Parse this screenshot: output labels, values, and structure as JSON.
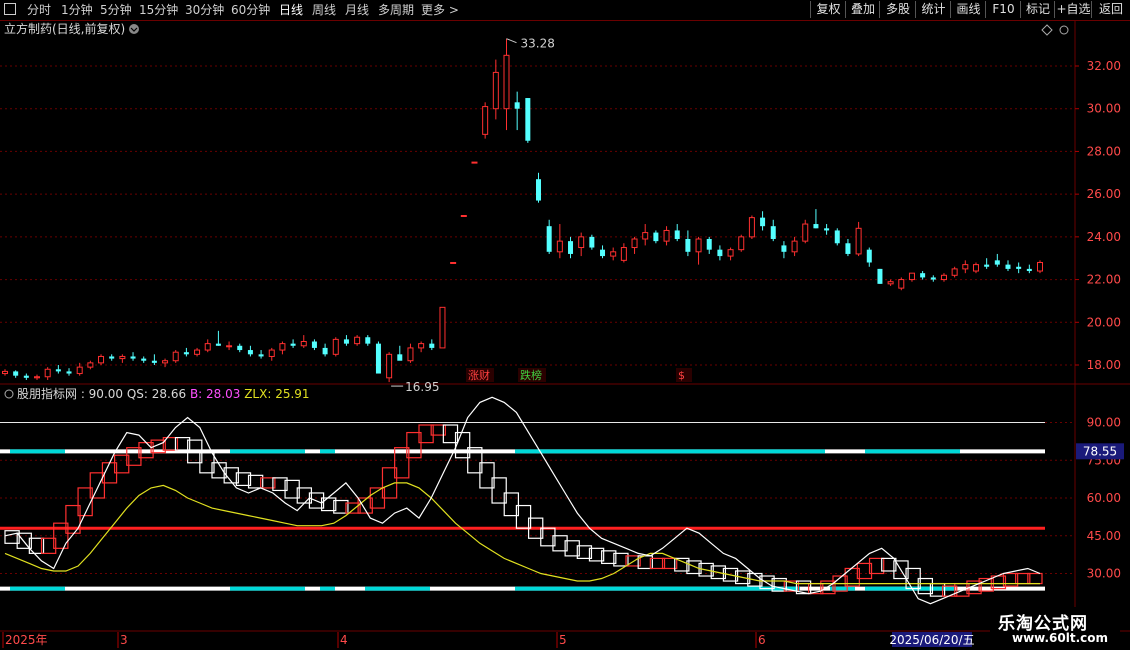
{
  "toolbar": {
    "left_items": [
      "分时",
      "1分钟",
      "5分钟",
      "15分钟",
      "30分钟",
      "60分钟",
      "日线",
      "周线",
      "月线",
      "多周期",
      "更多 >"
    ],
    "active_index": 6,
    "right_items": [
      "复权",
      "叠加",
      "多股",
      "统计",
      "画线",
      "F10",
      "标记",
      "+自选",
      "返回"
    ]
  },
  "main_panel": {
    "title": "立方制药(日线,前复权)",
    "y_ticks": [
      "32.00",
      "30.00",
      "28.00",
      "26.00",
      "24.00",
      "22.00",
      "20.00",
      "18.00"
    ],
    "high_label": "33.28",
    "low_label": "16.95",
    "markers": [
      {
        "text": "涨财",
        "color": "#ff4040"
      },
      {
        "text": "跌榜",
        "color": "#40d040"
      },
      {
        "text": "$",
        "color": "#ff4040"
      }
    ]
  },
  "indicator_panel": {
    "name": "股朋指标网",
    "params": ": 90.00",
    "qs_label": "QS: 28.66",
    "b_label": "B: 28.03",
    "zlx_label": "ZLX: 25.91",
    "y_ticks": [
      "90.00",
      "75.00",
      "60.00",
      "45.00",
      "30.00"
    ],
    "current_value": "78.55"
  },
  "x_axis": {
    "labels": [
      "2025年",
      "3",
      "4",
      "5",
      "6"
    ],
    "cursor_date": "2025/06/20/五"
  },
  "watermark": {
    "line1": "乐淘公式网",
    "line2": "www.60lt.com"
  },
  "colors": {
    "up": "#ff3030",
    "down": "#54ffff",
    "grid": "#6a0000",
    "qs": "#ffffff",
    "zlx": "#e0e020",
    "b": "#ff50ff",
    "signal_cyan": "#00d8d8"
  },
  "chart_data": [
    {
      "type": "candlestick",
      "title": "立方制药(日线,前复权)",
      "ylim": [
        17,
        33.5
      ],
      "max_label": 33.28,
      "min_label": 16.95,
      "candles": [
        [
          17.6,
          17.8,
          17.5,
          17.7
        ],
        [
          17.7,
          17.75,
          17.4,
          17.5
        ],
        [
          17.5,
          17.6,
          17.3,
          17.4
        ],
        [
          17.4,
          17.55,
          17.3,
          17.45
        ],
        [
          17.45,
          17.9,
          17.3,
          17.8
        ],
        [
          17.8,
          18.0,
          17.6,
          17.7
        ],
        [
          17.7,
          17.85,
          17.5,
          17.6
        ],
        [
          17.6,
          18.1,
          17.5,
          17.9
        ],
        [
          17.9,
          18.2,
          17.8,
          18.1
        ],
        [
          18.1,
          18.5,
          18.0,
          18.4
        ],
        [
          18.4,
          18.5,
          18.2,
          18.3
        ],
        [
          18.3,
          18.5,
          18.1,
          18.4
        ],
        [
          18.4,
          18.6,
          18.2,
          18.3
        ],
        [
          18.3,
          18.4,
          18.1,
          18.2
        ],
        [
          18.2,
          18.5,
          18.0,
          18.1
        ],
        [
          18.1,
          18.3,
          17.9,
          18.2
        ],
        [
          18.2,
          18.7,
          18.1,
          18.6
        ],
        [
          18.6,
          18.8,
          18.4,
          18.5
        ],
        [
          18.5,
          18.8,
          18.4,
          18.7
        ],
        [
          18.7,
          19.2,
          18.6,
          19.0
        ],
        [
          19.0,
          19.6,
          18.9,
          18.9
        ],
        [
          18.9,
          19.1,
          18.7,
          18.9
        ],
        [
          18.9,
          19.0,
          18.6,
          18.7
        ],
        [
          18.7,
          18.9,
          18.4,
          18.5
        ],
        [
          18.5,
          18.7,
          18.3,
          18.4
        ],
        [
          18.4,
          18.8,
          18.2,
          18.7
        ],
        [
          18.7,
          19.1,
          18.5,
          19.0
        ],
        [
          19.0,
          19.2,
          18.8,
          18.9
        ],
        [
          18.9,
          19.4,
          18.8,
          19.1
        ],
        [
          19.1,
          19.2,
          18.7,
          18.8
        ],
        [
          18.8,
          19.0,
          18.4,
          18.5
        ],
        [
          18.5,
          19.3,
          18.4,
          19.2
        ],
        [
          19.2,
          19.4,
          18.9,
          19.0
        ],
        [
          19.0,
          19.4,
          18.9,
          19.3
        ],
        [
          19.3,
          19.4,
          18.9,
          19.0
        ],
        [
          19.0,
          19.1,
          17.8,
          17.6
        ],
        [
          17.4,
          18.6,
          17.2,
          18.5
        ],
        [
          18.5,
          18.9,
          18.3,
          18.2
        ],
        [
          18.2,
          19.0,
          18.1,
          18.8
        ],
        [
          18.8,
          19.1,
          18.6,
          19.0
        ],
        [
          19.0,
          19.2,
          18.7,
          18.8
        ],
        [
          18.8,
          20.7,
          18.8,
          20.7
        ],
        [
          22.8,
          22.8,
          22.8,
          22.8
        ],
        [
          25.0,
          25.0,
          25.0,
          25.0
        ],
        [
          27.5,
          27.5,
          27.5,
          27.5
        ],
        [
          28.8,
          30.3,
          28.6,
          30.1
        ],
        [
          30.0,
          32.3,
          29.5,
          31.7
        ],
        [
          30.0,
          33.28,
          29.0,
          32.5
        ],
        [
          30.3,
          30.8,
          29.0,
          30.0
        ],
        [
          30.5,
          30.5,
          28.4,
          28.5
        ],
        [
          26.7,
          27.0,
          25.6,
          25.7
        ],
        [
          24.5,
          24.8,
          23.2,
          23.3
        ],
        [
          23.3,
          24.6,
          23.0,
          23.8
        ],
        [
          23.8,
          24.0,
          23.0,
          23.2
        ],
        [
          23.5,
          24.2,
          23.1,
          24.0
        ],
        [
          24.0,
          24.1,
          23.4,
          23.5
        ],
        [
          23.4,
          23.6,
          23.0,
          23.1
        ],
        [
          23.1,
          23.5,
          22.9,
          23.3
        ],
        [
          22.9,
          23.7,
          22.8,
          23.5
        ],
        [
          23.5,
          24.0,
          23.2,
          23.9
        ],
        [
          23.9,
          24.6,
          23.6,
          24.2
        ],
        [
          24.2,
          24.3,
          23.7,
          23.8
        ],
        [
          23.8,
          24.5,
          23.6,
          24.3
        ],
        [
          24.3,
          24.6,
          23.8,
          23.9
        ],
        [
          23.9,
          24.3,
          23.1,
          23.3
        ],
        [
          23.3,
          24.0,
          22.7,
          23.9
        ],
        [
          23.9,
          24.0,
          23.2,
          23.4
        ],
        [
          23.4,
          23.6,
          22.9,
          23.1
        ],
        [
          23.1,
          23.5,
          22.9,
          23.4
        ],
        [
          23.4,
          24.1,
          23.3,
          24.0
        ],
        [
          24.0,
          25.0,
          23.9,
          24.9
        ],
        [
          24.9,
          25.2,
          24.3,
          24.5
        ],
        [
          24.5,
          24.8,
          23.8,
          23.9
        ],
        [
          23.6,
          23.8,
          23.0,
          23.3
        ],
        [
          23.3,
          24.0,
          23.1,
          23.8
        ],
        [
          23.8,
          24.8,
          23.7,
          24.6
        ],
        [
          24.6,
          25.3,
          24.4,
          24.4
        ],
        [
          24.4,
          24.6,
          24.1,
          24.3
        ],
        [
          24.3,
          24.4,
          23.6,
          23.7
        ],
        [
          23.7,
          23.9,
          23.1,
          23.2
        ],
        [
          23.2,
          24.7,
          23.1,
          24.4
        ],
        [
          23.4,
          23.5,
          22.6,
          22.8
        ],
        [
          22.5,
          22.5,
          21.8,
          21.8
        ],
        [
          21.8,
          22.0,
          21.7,
          21.9
        ],
        [
          21.6,
          22.1,
          21.5,
          22.0
        ],
        [
          22.0,
          22.3,
          21.9,
          22.3
        ],
        [
          22.3,
          22.4,
          22.0,
          22.1
        ],
        [
          22.1,
          22.2,
          21.9,
          22.0
        ],
        [
          22.0,
          22.3,
          21.9,
          22.2
        ],
        [
          22.2,
          22.6,
          22.1,
          22.5
        ],
        [
          22.5,
          22.9,
          22.3,
          22.7
        ],
        [
          22.4,
          22.8,
          22.3,
          22.7
        ],
        [
          22.7,
          23.0,
          22.5,
          22.6
        ],
        [
          22.9,
          23.2,
          22.6,
          22.7
        ],
        [
          22.7,
          22.9,
          22.4,
          22.5
        ],
        [
          22.6,
          22.8,
          22.3,
          22.5
        ],
        [
          22.5,
          22.7,
          22.3,
          22.4
        ],
        [
          22.4,
          22.9,
          22.3,
          22.8
        ]
      ]
    },
    {
      "type": "line",
      "title": "股朋指标网",
      "ylim": [
        17,
        105
      ],
      "reference_lines": [
        90,
        78.55,
        48,
        24
      ],
      "series": [
        {
          "name": "QS",
          "values": [
            45,
            46,
            40,
            35,
            32,
            42,
            48,
            58,
            68,
            78,
            86,
            85,
            80,
            82,
            88,
            92,
            88,
            78,
            70,
            64,
            62,
            64,
            62,
            58,
            55,
            60,
            58,
            62,
            66,
            60,
            52,
            50,
            54,
            56,
            52,
            60,
            70,
            80,
            92,
            98,
            100,
            98,
            94,
            86,
            78,
            70,
            62,
            54,
            48,
            44,
            42,
            40,
            38,
            37,
            40,
            44,
            48,
            46,
            42,
            38,
            36,
            32,
            28,
            25,
            24,
            23,
            22,
            23,
            26,
            30,
            34,
            38,
            40,
            36,
            28,
            20,
            18,
            20,
            22,
            24,
            26,
            28,
            30,
            31,
            32,
            30
          ]
        },
        {
          "name": "B",
          "values": [
            45,
            44,
            42,
            40,
            42,
            48,
            55,
            62,
            68,
            72,
            75,
            78,
            80,
            81,
            82,
            81,
            76,
            72,
            70,
            68,
            67,
            66,
            66,
            65,
            62,
            60,
            58,
            57,
            56,
            56,
            58,
            62,
            70,
            78,
            84,
            87,
            87,
            84,
            78,
            72,
            66,
            60,
            55,
            50,
            46,
            43,
            41,
            39,
            38,
            37,
            36,
            35,
            35,
            34,
            34,
            34,
            33,
            32,
            31,
            30,
            29,
            28,
            27,
            26,
            25,
            25,
            24,
            24,
            25,
            27,
            30,
            32,
            34,
            33,
            30,
            26,
            24,
            23,
            23,
            24,
            25,
            26,
            27,
            28,
            28,
            28
          ]
        },
        {
          "name": "ZLX",
          "values": [
            38,
            36,
            34,
            32,
            31,
            31,
            33,
            38,
            44,
            50,
            56,
            61,
            64,
            65,
            63,
            60,
            58,
            56,
            55,
            54,
            53,
            52,
            51,
            50,
            49,
            49,
            49,
            50,
            53,
            57,
            61,
            64,
            66,
            66,
            64,
            60,
            55,
            50,
            46,
            42,
            39,
            36,
            34,
            32,
            30,
            29,
            28,
            27,
            27,
            28,
            30,
            33,
            36,
            38,
            38,
            36,
            34,
            32,
            31,
            30,
            29,
            28,
            27,
            27,
            27,
            26,
            26,
            26,
            26,
            26,
            26,
            26,
            26,
            26,
            26,
            26,
            26,
            26,
            26,
            26,
            26,
            26,
            26,
            26,
            26,
            26
          ]
        }
      ],
      "current_values": {
        "QS": 28.66,
        "B": 28.03,
        "ZLX": 25.91,
        "param": 90.0
      }
    }
  ]
}
